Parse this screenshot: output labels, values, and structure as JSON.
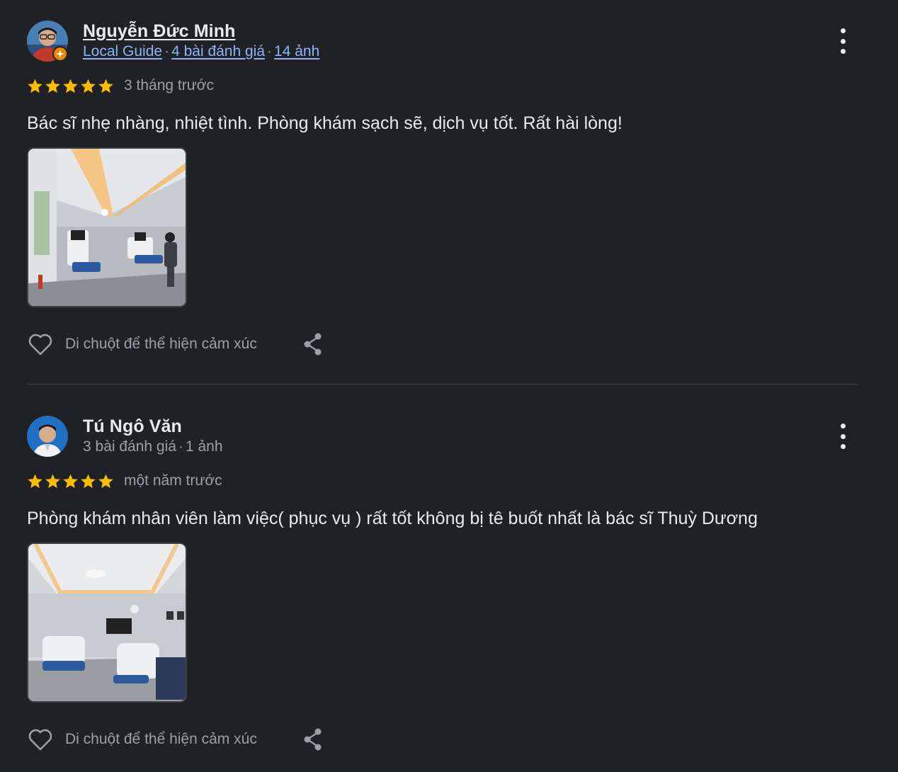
{
  "reviews": [
    {
      "author": "Nguyễn Đức Minh",
      "local_guide": "Local Guide",
      "reviews_count": "4 bài đánh giá",
      "photos_count": "14 ảnh",
      "separator": "·",
      "rating": 5,
      "time": "3 tháng trước",
      "text": "Bác sĩ nhẹ nhàng, nhiệt tình. Phòng khám sạch sẽ, dịch vụ tốt. Rất hài lòng!",
      "react_label": "Di chuột để thể hiện cảm xúc"
    },
    {
      "author": "Tú Ngô Văn",
      "reviews_count": "3 bài đánh giá",
      "photos_count": "1 ảnh",
      "separator": "·",
      "rating": 5,
      "time": "một năm trước",
      "text": "Phòng khám nhân viên làm việc( phục vụ ) rất tốt không bị tê buốt nhất là bác sĩ Thuỳ Dương",
      "react_label": "Di chuột để thể hiện cảm xúc"
    }
  ],
  "colors": {
    "background": "#202124",
    "star": "#fbbc04",
    "link": "#8ab4f8",
    "secondary_text": "#9aa0a6",
    "local_guide_badge": "#ea8600"
  },
  "icons": {
    "more": "more-vert-icon",
    "heart": "heart-outline-icon",
    "share": "share-icon",
    "star": "star-icon",
    "badge": "local-guide-badge-icon"
  }
}
